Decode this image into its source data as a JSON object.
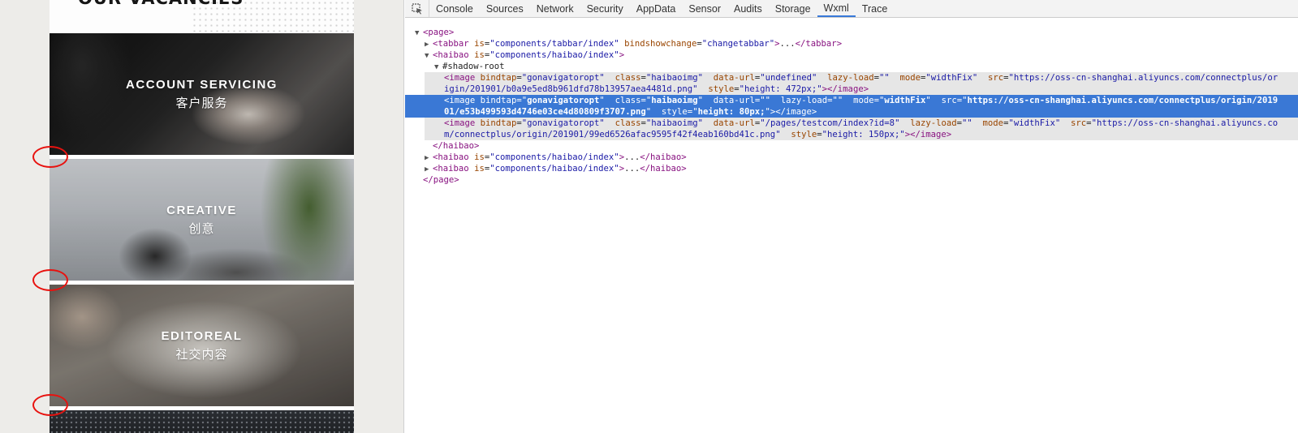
{
  "simulator": {
    "header_title": "OUR VACANCIES",
    "banners": [
      {
        "en": "ACCOUNT SERVICING",
        "zh": "客户服务"
      },
      {
        "en": "CREATIVE",
        "zh": "创意"
      },
      {
        "en": "EDITOREAL",
        "zh": "社交内容"
      }
    ],
    "annotation_color": "#e8120f"
  },
  "devtools": {
    "tabs": [
      "Console",
      "Sources",
      "Network",
      "Security",
      "AppData",
      "Sensor",
      "Audits",
      "Storage",
      "Wxml",
      "Trace"
    ],
    "active_tab": "Wxml",
    "tree": {
      "page_open": "page",
      "tabbar_tag": "tabbar",
      "tabbar_is": "components/tabbar/index",
      "tabbar_bind_attr": "bindshowchange",
      "tabbar_bind_val": "changetabbar",
      "haibao_tag": "haibao",
      "haibao_is": "components/haibao/index",
      "shadow_root": "#shadow-root",
      "img1": {
        "bindtap": "gonavigatoropt",
        "class": "haibaoimg",
        "data_url": "undefined",
        "lazy_load": "",
        "mode": "widthFix",
        "src_line1": "https://oss-cn-shanghai.aliyuncs.com/connectplus/or",
        "src_line2": "igin/201901/b0a9e5ed8b961dfd78b13957aea4481d.png",
        "style": "height: 472px;"
      },
      "img2": {
        "bindtap": "gonavigatoropt",
        "class": "haibaoimg",
        "data_url": "",
        "lazy_load": "",
        "mode": "widthFix",
        "src_line1": "https://oss-cn-shanghai.aliyuncs.com/connectplus/origin/2019",
        "src_line2": "01/e53b499593d4746e03ce4d80809f3707.png",
        "style": "height: 80px;"
      },
      "img3": {
        "bindtap": "gonavigatoropt",
        "class": "haibaoimg",
        "data_url": "/pages/testcom/index?id=8",
        "lazy_load": "",
        "mode": "widthFix",
        "src_line1": "https://oss-cn-shanghai.aliyuncs.co",
        "src_line2": "m/connectplus/origin/201901/99ed6526afac9595f42f4eab160bd41c.png",
        "style": "height: 150px;"
      },
      "ellipsis": "...",
      "page_close": "page"
    }
  }
}
